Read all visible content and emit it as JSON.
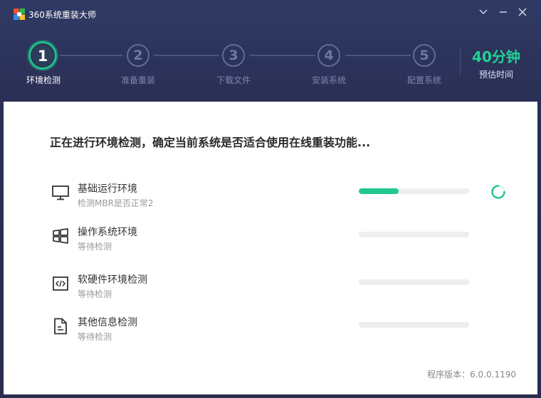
{
  "window": {
    "title": "360系统重装大师"
  },
  "titlebar": {
    "menu_icon": "chevron-down-icon",
    "minimize_icon": "minimize-icon",
    "close_icon": "close-icon"
  },
  "steps": [
    {
      "number": "1",
      "label": "环境检测",
      "active": true
    },
    {
      "number": "2",
      "label": "准备重装",
      "active": false
    },
    {
      "number": "3",
      "label": "下载文件",
      "active": false
    },
    {
      "number": "4",
      "label": "安装系统",
      "active": false
    },
    {
      "number": "5",
      "label": "配置系统",
      "active": false
    }
  ],
  "estimate": {
    "time": "40分钟",
    "label": "预估时间"
  },
  "main": {
    "heading": "正在进行环境检测，确定当前系统是否适合使用在线重装功能...",
    "checks": [
      {
        "title": "基础运行环境",
        "status": "检测MBR是否正常2",
        "icon": "monitor-icon",
        "progress": 0.36
      },
      {
        "title": "操作系统环境",
        "status": "等待检测",
        "icon": "windows-icon",
        "progress": 0
      },
      {
        "title": "软硬件环境检测",
        "status": "等待检测",
        "icon": "code-icon",
        "progress": 0
      },
      {
        "title": "其他信息检测",
        "status": "等待检测",
        "icon": "document-icon",
        "progress": 0
      }
    ]
  },
  "footer": {
    "version": "程序版本：6.0.0.1190"
  },
  "colors": {
    "accent": "#21c88c",
    "header_bg": "#2b2f55",
    "track": "#eceef0"
  }
}
